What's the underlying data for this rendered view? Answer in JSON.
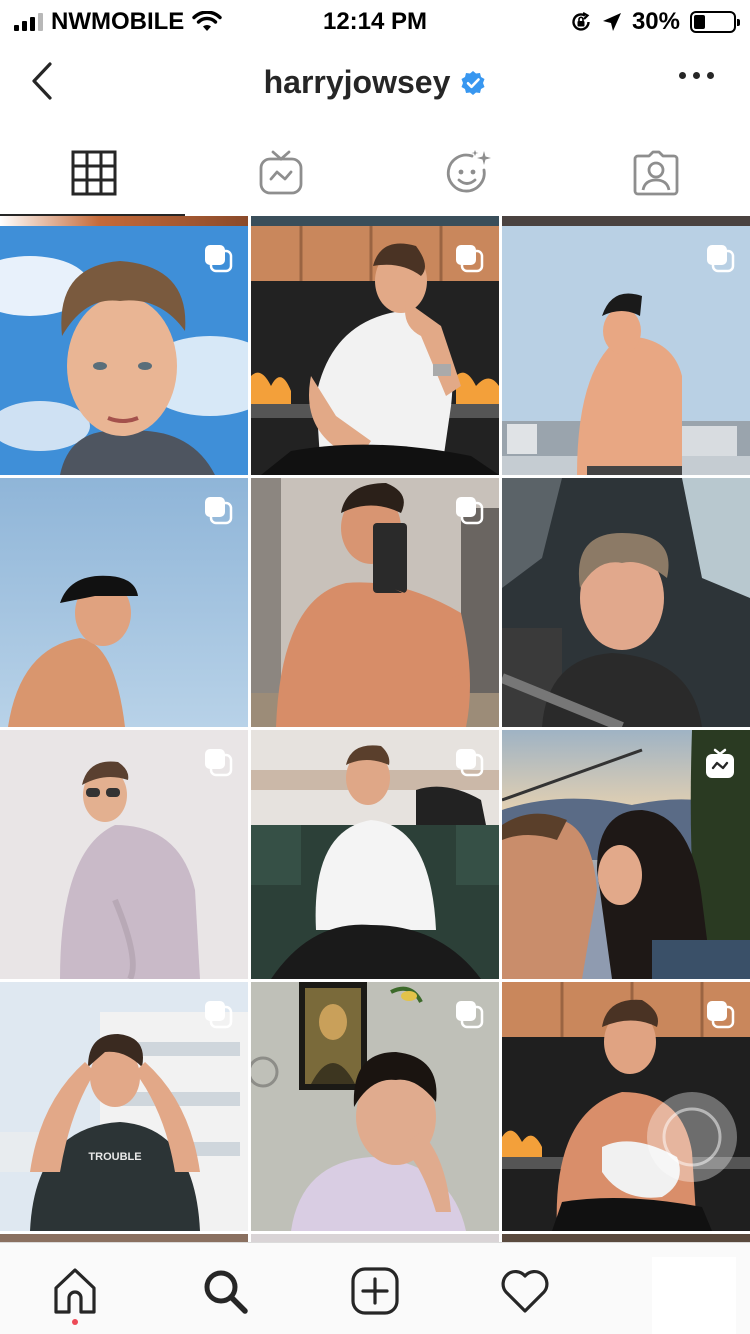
{
  "status_bar": {
    "carrier": "NWMOBILE",
    "time": "12:14 PM",
    "battery": "30%",
    "battery_level": 0.3,
    "icons": [
      "signal-icon",
      "wifi-icon",
      "orientation-lock-icon",
      "location-icon",
      "battery-icon"
    ]
  },
  "header": {
    "username": "harryjowsey",
    "verified": true,
    "icons": [
      "back-arrow-icon",
      "verified-badge-icon",
      "more-options-icon"
    ]
  },
  "tabs": [
    {
      "name": "posts-grid",
      "icon": "grid-icon",
      "active": true
    },
    {
      "name": "igtv",
      "icon": "igtv-icon",
      "active": false
    },
    {
      "name": "effects",
      "icon": "face-effects-icon",
      "active": false
    },
    {
      "name": "tagged",
      "icon": "tagged-person-icon",
      "active": false
    }
  ],
  "grid": {
    "tiles": [
      {
        "row": 1,
        "col": 1,
        "type": "carousel",
        "scene": "selfie against blue sky"
      },
      {
        "row": 1,
        "col": 2,
        "type": "carousel",
        "scene": "white tee by fire pit"
      },
      {
        "row": 1,
        "col": 3,
        "type": "carousel",
        "scene": "shirtless rooftop city view"
      },
      {
        "row": 2,
        "col": 1,
        "type": "carousel",
        "scene": "backwards cap against sky"
      },
      {
        "row": 2,
        "col": 2,
        "type": "carousel",
        "scene": "mirror selfie"
      },
      {
        "row": 2,
        "col": 3,
        "type": "photo",
        "scene": "car selfie"
      },
      {
        "row": 3,
        "col": 1,
        "type": "carousel",
        "scene": "lilac sweater sunglasses"
      },
      {
        "row": 3,
        "col": 2,
        "type": "carousel",
        "scene": "seated on green sofa"
      },
      {
        "row": 3,
        "col": 3,
        "type": "igtv",
        "scene": "kiss on chairlift",
        "highlighted": true
      },
      {
        "row": 4,
        "col": 1,
        "type": "carousel",
        "scene": "trouble tee by building"
      },
      {
        "row": 4,
        "col": 2,
        "type": "carousel",
        "scene": "portrait with artwork"
      },
      {
        "row": 4,
        "col": 3,
        "type": "carousel",
        "scene": "smiling by fire pit"
      }
    ],
    "shirt_text": "TROUBLE"
  },
  "bottom_nav": {
    "items": [
      {
        "name": "home",
        "icon": "home-icon",
        "active": true
      },
      {
        "name": "search",
        "icon": "search-icon",
        "active": false
      },
      {
        "name": "new-post",
        "icon": "add-post-icon",
        "active": false
      },
      {
        "name": "activity",
        "icon": "heart-icon",
        "active": false
      }
    ],
    "notification_color": "#ed4956"
  },
  "colors": {
    "highlight_border": "#e8321e",
    "verified_blue": "#3897f0",
    "text": "#262626"
  }
}
